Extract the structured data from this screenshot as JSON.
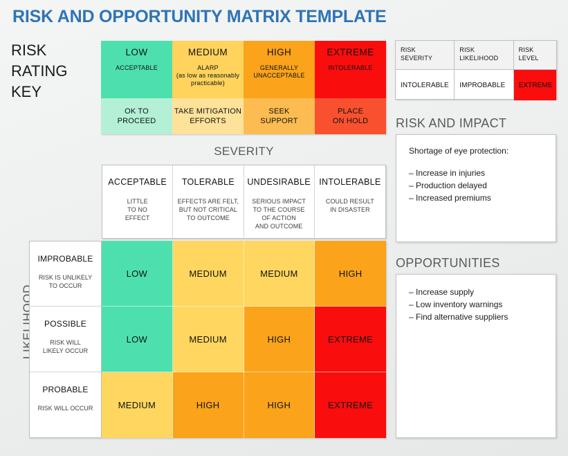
{
  "title": "RISK AND OPPORTUNITY MATRIX TEMPLATE",
  "accent_color": "#2e74b5",
  "rating_key": {
    "heading_line1": "RISK",
    "heading_line2": "RATING",
    "heading_line3": "KEY",
    "levels": [
      {
        "name": "LOW",
        "descriptor": "ACCEPTABLE",
        "action": "OK TO\nPROCEED",
        "color": "#4de0ae",
        "action_color": "#b3f0d6"
      },
      {
        "name": "MEDIUM",
        "descriptor": "ALARP\n(as low as reasonably\npracticable)",
        "action": "TAKE MITIGATION\nEFFORTS",
        "color": "#ffd35c",
        "action_color": "#ffe29a"
      },
      {
        "name": "HIGH",
        "descriptor": "GENERALLY\nUNACCEPTABLE",
        "action": "SEEK\nSUPPORT",
        "color": "#faa31b",
        "action_color": "#fcbc52"
      },
      {
        "name": "EXTREME",
        "descriptor": "INTOLERABLE",
        "action": "PLACE\nON HOLD",
        "color": "#fa0d0d",
        "action_color": "#f9512f"
      }
    ]
  },
  "matrix": {
    "x_axis_label": "SEVERITY",
    "y_axis_label": "LIKELIHOOD",
    "severity_columns": [
      {
        "name": "ACCEPTABLE",
        "description": "LITTLE\nTO NO\nEFFECT"
      },
      {
        "name": "TOLERABLE",
        "description": "EFFECTS ARE FELT,\nBUT NOT CRITICAL\nTO OUTCOME"
      },
      {
        "name": "UNDESIRABLE",
        "description": "SERIOUS IMPACT\nTO THE COURSE\nOF ACTION\nAND OUTCOME"
      },
      {
        "name": "INTOLERABLE",
        "description": "COULD RESULT\nIN DISASTER"
      }
    ],
    "likelihood_rows": [
      {
        "name": "IMPROBABLE",
        "description": "RISK IS UNLIKELY\nTO OCCUR"
      },
      {
        "name": "POSSIBLE",
        "description": "RISK WILL\nLIKELY OCCUR"
      },
      {
        "name": "PROBABLE",
        "description": "RISK WILL OCCUR"
      }
    ],
    "cells": [
      [
        {
          "label": "LOW",
          "color": "#4de0ae"
        },
        {
          "label": "MEDIUM",
          "color": "#ffd65f"
        },
        {
          "label": "MEDIUM",
          "color": "#ffd65f"
        },
        {
          "label": "HIGH",
          "color": "#faa31b"
        }
      ],
      [
        {
          "label": "LOW",
          "color": "#4de0ae"
        },
        {
          "label": "MEDIUM",
          "color": "#ffd65f"
        },
        {
          "label": "HIGH",
          "color": "#faa31b"
        },
        {
          "label": "EXTREME",
          "color": "#fa0d0d"
        }
      ],
      [
        {
          "label": "MEDIUM",
          "color": "#ffd65f"
        },
        {
          "label": "HIGH",
          "color": "#faa31b"
        },
        {
          "label": "HIGH",
          "color": "#faa31b"
        },
        {
          "label": "EXTREME",
          "color": "#fa0d0d"
        }
      ]
    ]
  },
  "summary_table": {
    "headers": [
      "RISK\nSEVERITY",
      "RISK\nLIKELIHOOD",
      "RISK\nLEVEL"
    ],
    "row": [
      "INTOLERABLE",
      "IMPROBABLE",
      "EXTREME"
    ],
    "level_color": "#fa0d0d"
  },
  "risk_and_impact": {
    "heading": "RISK AND IMPACT",
    "title": "Shortage of eye protection:",
    "items": [
      "– Increase in injuries",
      "– Production delayed",
      "– Increased premiums"
    ]
  },
  "opportunities": {
    "heading": "OPPORTUNITIES",
    "items": [
      "– Increase supply",
      "– Low inventory warnings",
      "– Find alternative suppliers"
    ]
  }
}
